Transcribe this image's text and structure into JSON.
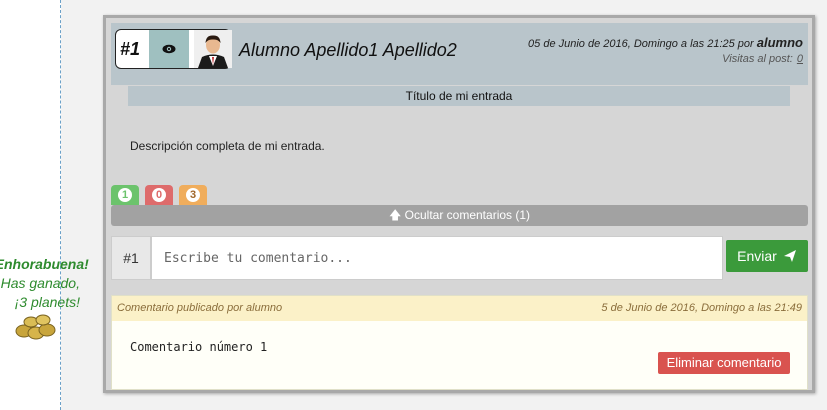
{
  "sidebar": {
    "congrats_line1": "¡Enhorabuena!",
    "congrats_line2": "Has ganado,",
    "congrats_line3": "¡3 planets!",
    "coins_icon": "coins-icon"
  },
  "post": {
    "number": "#1",
    "author": "Alumno Apellido1 Apellido2",
    "date_text": "05 de Junio de 2016, Domingo a las 21:25 por",
    "date_user": "alumno",
    "visits_label": "Visitas al post:",
    "visits_value": "0",
    "title": "Título de mi entrada",
    "description": "Descripción completa de mi entrada.",
    "votes": {
      "positive": "1",
      "negative": "0",
      "neutral": "3"
    },
    "toggle_comments": "Ocultar comentarios (1)"
  },
  "comment_form": {
    "number": "#1",
    "placeholder": "Escribe tu comentario...",
    "send_label": "Enviar"
  },
  "comment": {
    "header_left": "Comentario publicado por alumno",
    "header_right": "5 de Junio de 2016, Domingo a las 21:49",
    "text": "Comentario número 1",
    "delete_label": "Eliminar comentario"
  },
  "colors": {
    "send": "#3b9a3b",
    "delete": "#d9534f",
    "header": "#b9c5cb"
  }
}
